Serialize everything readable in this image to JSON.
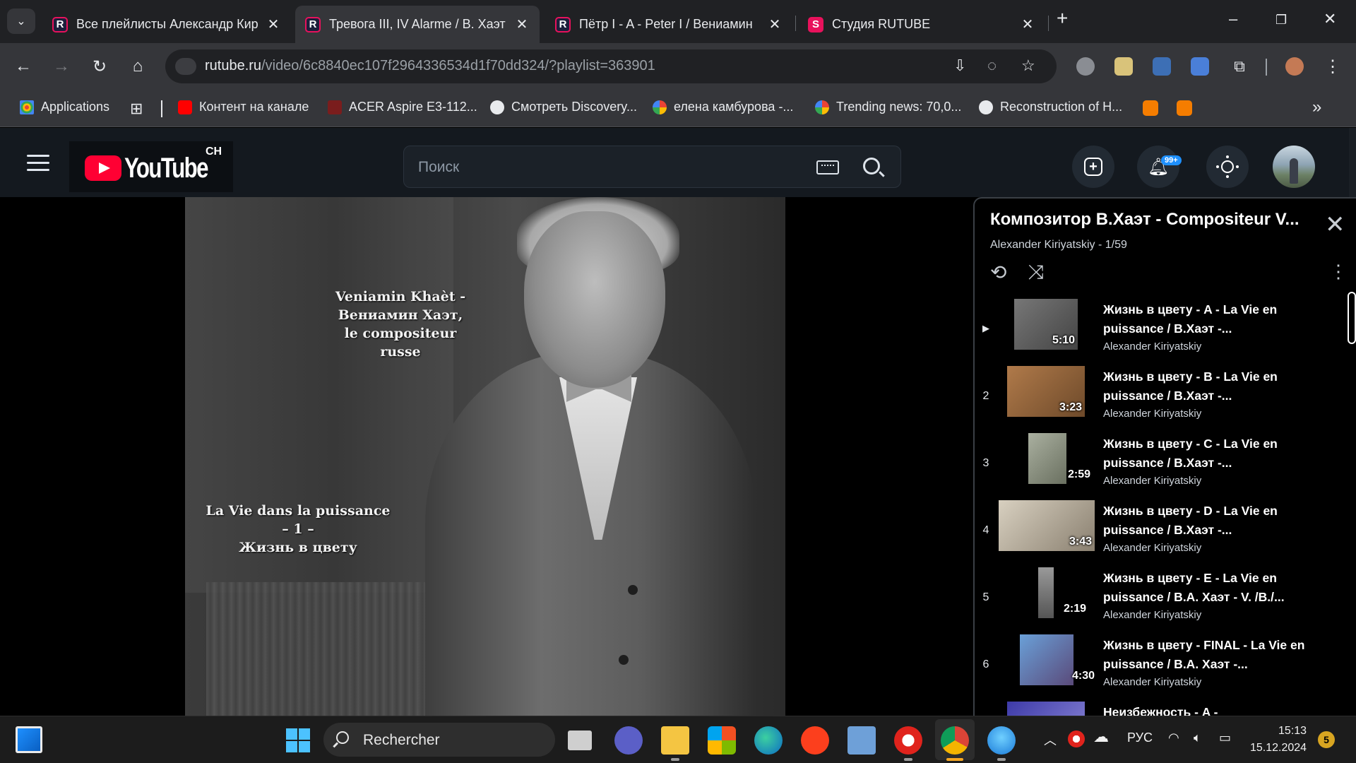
{
  "browser": {
    "tabs": [
      {
        "title": "Все плейлисты Александр Кир",
        "favicon": "rutube-icon",
        "active": false
      },
      {
        "title": "Тревога III, IV Alarme / В. Хаэт",
        "favicon": "rutube-icon",
        "active": true
      },
      {
        "title": "Пётр I - A - Peter I / Вениамин",
        "favicon": "rutube-icon",
        "active": false
      },
      {
        "title": "Студия RUTUBE",
        "favicon": "rutube-studio-icon",
        "active": false
      }
    ],
    "url_host": "rutube.ru",
    "url_path": "/video/6c8840ec107f2964336534d1f70dd324/?playlist=363901",
    "bookmarks": [
      {
        "label": "Applications",
        "icon": "apps-grid-icon"
      },
      {
        "label": "Контент на канале",
        "icon": "youtube-icon"
      },
      {
        "label": "ACER Aspire E3-112...",
        "icon": "acer-icon"
      },
      {
        "label": "Смотреть Discovery...",
        "icon": "globe-icon"
      },
      {
        "label": "елена камбурова -...",
        "icon": "google-icon"
      },
      {
        "label": "Trending news: 70,0...",
        "icon": "google-icon"
      },
      {
        "label": "Reconstruction of H...",
        "icon": "globe-icon"
      }
    ],
    "overflow_label": "»"
  },
  "site": {
    "logo_text": "YouTube",
    "logo_sup": "CH",
    "search_placeholder": "Поиск",
    "notifications_badge": "99+"
  },
  "video": {
    "overlay_top": [
      "Veniamin Khaèt -",
      "Вениамин Хаэт,",
      "le compositeur",
      "russe"
    ],
    "overlay_bottom": [
      "La Vie dans la puissance",
      "– 1 –",
      "Жизнь в цвету"
    ]
  },
  "playlist": {
    "title": "Композитор В.Хаэт - Compositeur V...",
    "subtitle": "Alexander Kiriyatskiy - 1/59",
    "items": [
      {
        "index": "▶",
        "duration": "5:10",
        "title": "Жизнь в цвету - A - La Vie en puissance / В.Хаэт -...",
        "author": "Alexander Kiriyatskiy"
      },
      {
        "index": "2",
        "duration": "3:23",
        "title": "Жизнь в цвету - B - La Vie en puissance / В.Хаэт -...",
        "author": "Alexander Kiriyatskiy"
      },
      {
        "index": "3",
        "duration": "2:59",
        "title": "Жизнь в цвету - C - La Vie en puissance / В.Хаэт -...",
        "author": "Alexander Kiriyatskiy"
      },
      {
        "index": "4",
        "duration": "3:43",
        "title": "Жизнь в цвету - D - La Vie en puissance / В.Хаэт -...",
        "author": "Alexander Kiriyatskiy"
      },
      {
        "index": "5",
        "duration": "2:19",
        "title": "Жизнь в цвету - E - La Vie en puissance / В.А. Хаэт - V. /В./...",
        "author": "Alexander Kiriyatskiy"
      },
      {
        "index": "6",
        "duration": "4:30",
        "title": "Жизнь в цвету - FINAL - La Vie en puissance / В.А. Хаэт -...",
        "author": "Alexander Kiriyatskiy"
      },
      {
        "index": "",
        "duration": "",
        "title": "Неизбежность - A -",
        "author": ""
      }
    ]
  },
  "taskbar": {
    "search_text": "Rechercher",
    "language": "РУС",
    "time": "15:13",
    "date": "15.12.2024",
    "notification_count": "5"
  }
}
